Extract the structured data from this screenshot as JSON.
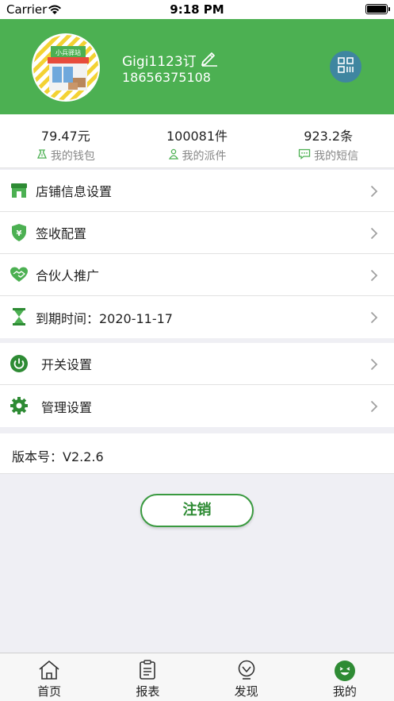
{
  "status_bar": {
    "carrier": "Carrier",
    "time": "9:18 PM"
  },
  "profile": {
    "store_sign": "小兵驿站",
    "username": "Gigi1123订",
    "phone": "18656375108"
  },
  "stats": [
    {
      "value": "79.47元",
      "label": "我的钱包",
      "icon": "wallet-icon"
    },
    {
      "value": "100081件",
      "label": "我的派件",
      "icon": "courier-icon"
    },
    {
      "value": "923.2条",
      "label": "我的短信",
      "icon": "message-icon"
    }
  ],
  "menu_group_1": [
    {
      "label": "店铺信息设置",
      "icon": "store-icon"
    },
    {
      "label": "签收配置",
      "icon": "shield-yen-icon"
    },
    {
      "label": "合伙人推广",
      "icon": "handshake-icon"
    },
    {
      "label": "到期时间：2020-11-17",
      "icon": "hourglass-icon"
    }
  ],
  "menu_group_2": [
    {
      "label": "开关设置",
      "icon": "power-icon"
    },
    {
      "label": "管理设置",
      "icon": "gear-icon"
    }
  ],
  "version": {
    "label": "版本号：V2.2.6"
  },
  "logout_label": "注销",
  "tabs": [
    {
      "label": "首页",
      "icon": "home-icon"
    },
    {
      "label": "报表",
      "icon": "clipboard-icon"
    },
    {
      "label": "发现",
      "icon": "discover-icon"
    },
    {
      "label": "我的",
      "icon": "smile-icon",
      "active": true
    }
  ],
  "colors": {
    "brand_green": "#4cb052",
    "accent_dark_green": "#2e8b34",
    "qr_button": "#3f86a0"
  }
}
